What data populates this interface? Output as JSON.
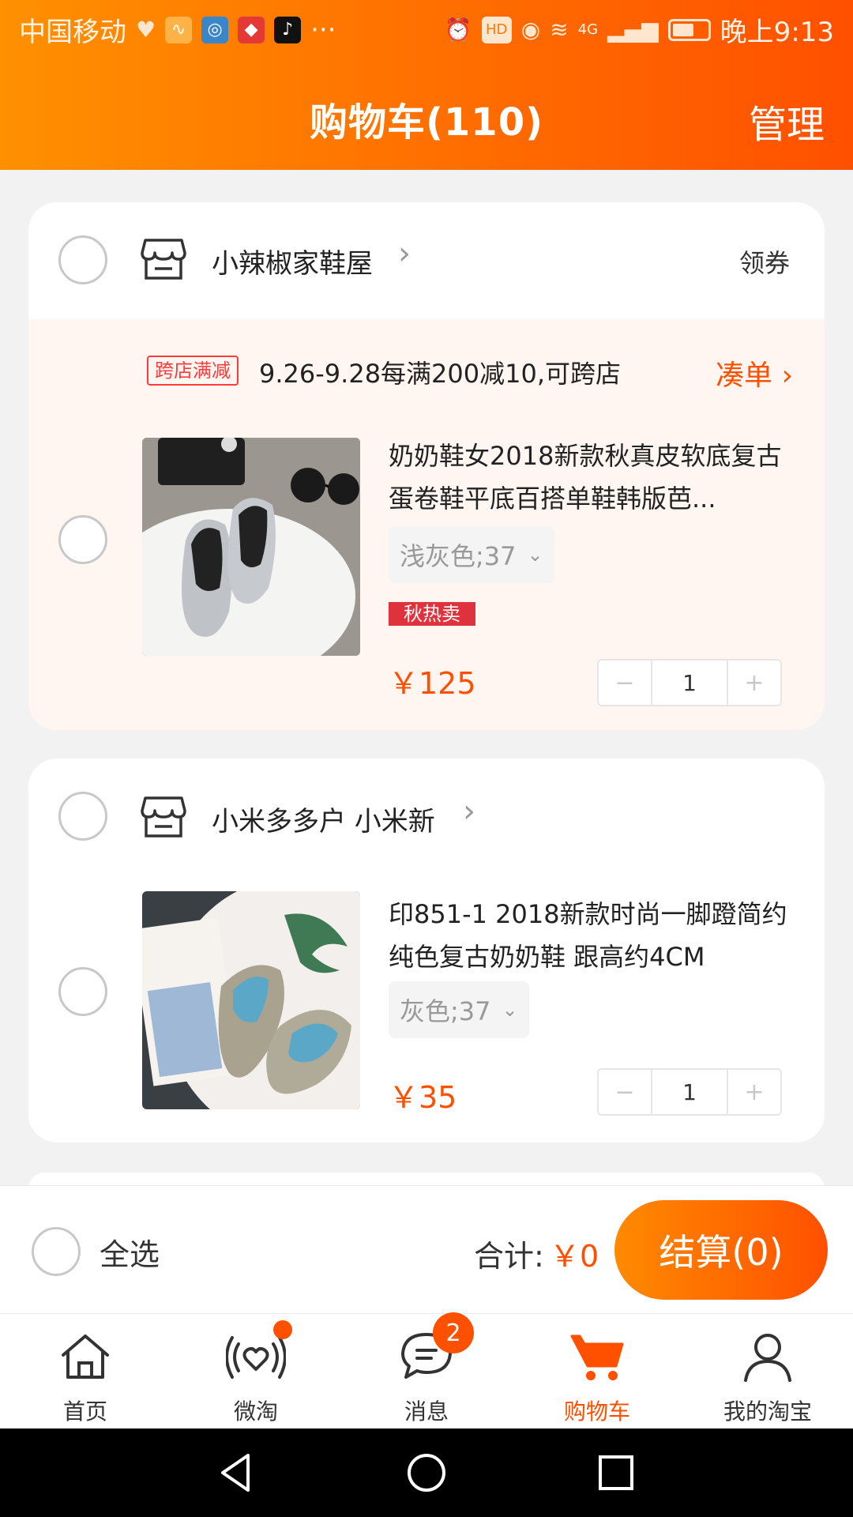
{
  "status_bar": {
    "carrier": "中国移动",
    "more": "···",
    "hd": "HD",
    "network": "4G",
    "time": "晚上9:13"
  },
  "header": {
    "title": "购物车(110)",
    "manage": "管理"
  },
  "shops": [
    {
      "name": "小辣椒家鞋屋",
      "coupon": "领券",
      "promo": {
        "tag": "跨店满减",
        "text": "9.26-9.28每满200减10,可跨店",
        "link": "凑单"
      },
      "item": {
        "title": "奶奶鞋女2018新款秋真皮软底复古蛋卷鞋平底百搭单鞋韩版芭...",
        "spec": "浅灰色;37",
        "badge": "秋热卖",
        "price": "￥125",
        "qty": "1"
      }
    },
    {
      "name": "小米多多户 小米新",
      "item": {
        "title": "印851-1 2018新款时尚一脚蹬简约纯色复古奶奶鞋 跟高约4CM",
        "spec": "灰色;37",
        "price": "￥35",
        "qty": "1"
      }
    }
  ],
  "settle": {
    "select_all": "全选",
    "total_label": "合计:",
    "total_value": "￥0",
    "checkout": "结算(0)"
  },
  "tabs": [
    {
      "label": "首页",
      "icon": "home-icon"
    },
    {
      "label": "微淘",
      "icon": "heart-signal-icon"
    },
    {
      "label": "消息",
      "icon": "chat-icon",
      "badge": "2"
    },
    {
      "label": "购物车",
      "icon": "cart-icon",
      "active": true
    },
    {
      "label": "我的淘宝",
      "icon": "user-icon"
    }
  ],
  "colors": {
    "brand_orange": "#ff5000",
    "header_gradient_start": "#ff9000",
    "badge_red": "#e0323d"
  }
}
